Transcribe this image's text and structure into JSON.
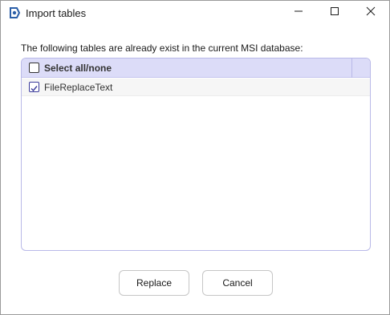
{
  "window": {
    "title": "Import tables"
  },
  "icons": {
    "app": "app-logo-icon",
    "minimize": "minimize-icon",
    "maximize": "maximize-icon",
    "close": "close-icon",
    "checkbox": "checkbox-icon"
  },
  "dialog": {
    "message": "The following tables are already exist in the current MSI database:",
    "list": {
      "header_label": "Select all/none",
      "header_checked": false,
      "rows": [
        {
          "label": "FileReplaceText",
          "checked": true
        }
      ]
    },
    "buttons": {
      "replace": "Replace",
      "cancel": "Cancel"
    }
  },
  "colors": {
    "accent": "#2b5fa8",
    "header_bg": "#dcdcf8",
    "panel_border": "#b9b9e8"
  }
}
